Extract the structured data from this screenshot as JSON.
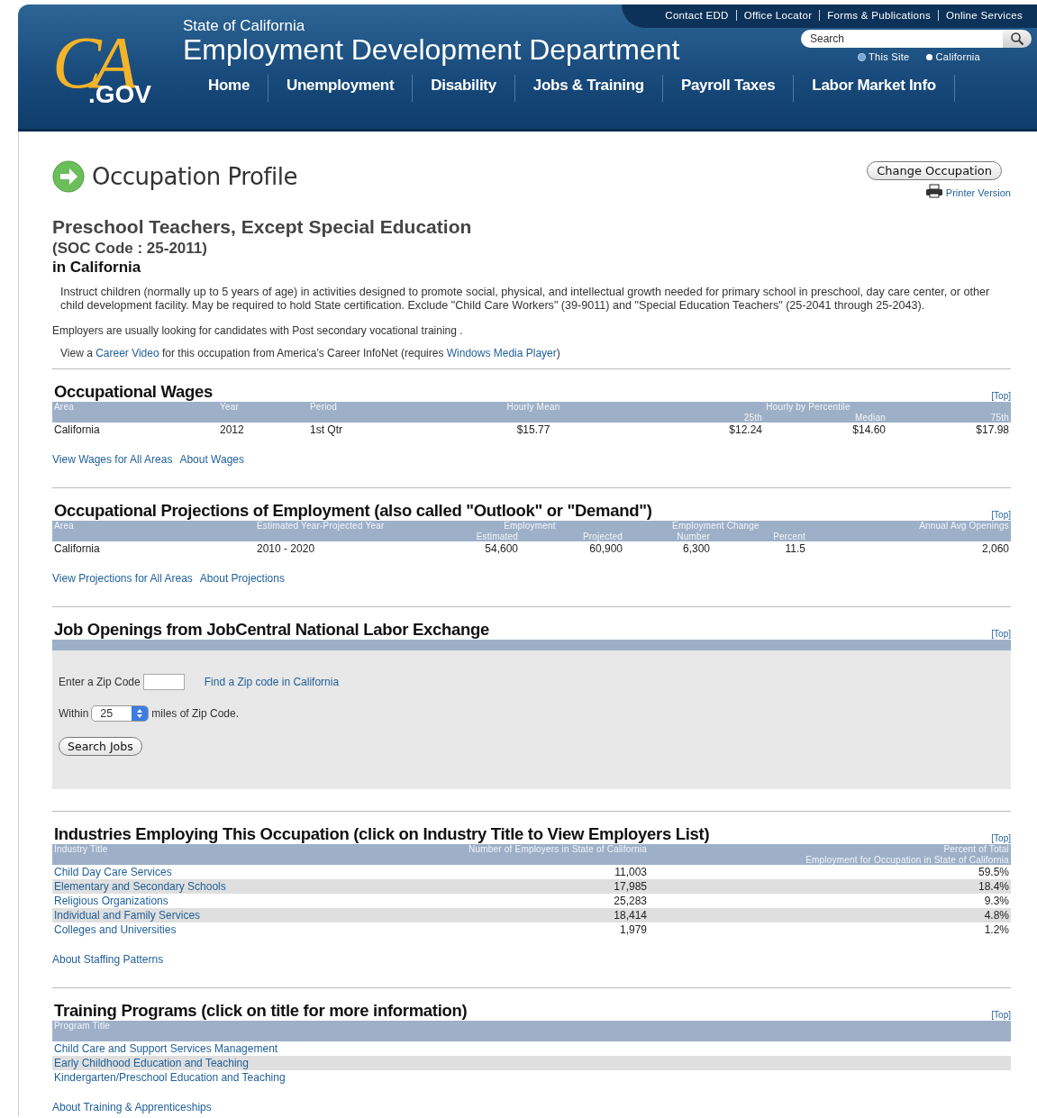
{
  "header": {
    "logo_mark": "CA",
    "logo_suffix": ".GOV",
    "state": "State of California",
    "department": "Employment Development Department",
    "utility_links": [
      "Contact EDD",
      "Office Locator",
      "Forms & Publications",
      "Online Services"
    ],
    "search": {
      "placeholder": "Search"
    },
    "search_scopes": [
      {
        "label": "This Site",
        "selected": true
      },
      {
        "label": "California",
        "selected": false
      }
    ],
    "nav": [
      "Home",
      "Unemployment",
      "Disability",
      "Jobs & Training",
      "Payroll Taxes",
      "Labor Market Info"
    ]
  },
  "profile": {
    "title": "Occupation Profile",
    "change_button": "Change Occupation",
    "printer_link": "Printer Version",
    "occupation": "Preschool Teachers, Except Special Education",
    "soc": "(SOC Code : 25-2011)",
    "location": "in California",
    "description": "Instruct children (normally up to 5 years of age) in activities designed to promote social, physical, and intellectual growth needed for primary school in preschool, day care center, or other child development facility. May be required to hold State certification. Exclude \"Child Care Workers\" (39-9011) and \"Special Education Teachers\" (25-2041 through 25-2043).",
    "education_note": "Employers are usually looking for candidates with Post secondary vocational training .",
    "video_note": [
      {
        "kind": "text",
        "text": "View a "
      },
      {
        "kind": "link",
        "text": "Career Video"
      },
      {
        "kind": "text",
        "text": " for this occupation from America's Career InfoNet (requires "
      },
      {
        "kind": "link",
        "text": "Windows Media Player"
      },
      {
        "kind": "text",
        "text": ")"
      }
    ]
  },
  "sections": [
    {
      "kind": "wages",
      "title": "Occupational Wages",
      "top_link": "[Top]",
      "header_groups": [
        "Hourly by Percentile"
      ],
      "columns": [
        "Area",
        "Year",
        "Period",
        "Hourly Mean",
        "25th",
        "Median",
        "75th"
      ],
      "rows": [
        [
          "California",
          "2012",
          "1st Qtr",
          "$15.77",
          "$12.24",
          "$14.60",
          "$17.98"
        ]
      ],
      "links": [
        "View Wages for All Areas",
        "About Wages"
      ]
    },
    {
      "kind": "projections",
      "title": "Occupational Projections of Employment (also called \"Outlook\" or \"Demand\")",
      "top_link": "[Top]",
      "header_groups": [
        "Employment",
        "Employment Change"
      ],
      "columns": [
        "Area",
        "Estimated Year-Projected Year",
        "Estimated",
        "Projected",
        "Number",
        "Percent",
        "Annual Avg Openings"
      ],
      "rows": [
        [
          "California",
          "2010 - 2020",
          "54,600",
          "60,900",
          "6,300",
          "11.5",
          "2,060"
        ]
      ],
      "links": [
        "View Projections for All Areas",
        "About Projections"
      ]
    },
    {
      "kind": "jobs",
      "title": "Job Openings from JobCentral National Labor Exchange",
      "top_link": "[Top]",
      "zip_label": "Enter a Zip Code",
      "zip_link": "Find a Zip code in California",
      "within_label": "Within",
      "radius": "25",
      "miles_label": "miles of Zip Code.",
      "search_button": "Search Jobs"
    },
    {
      "kind": "industries",
      "title": "Industries Employing This Occupation (click on Industry Title to View Employers List)",
      "top_link": "[Top]",
      "header_groups": [
        "Percent of Total"
      ],
      "columns": [
        "Industry Title",
        "Number of Employers in State of California",
        "Employment for Occupation in State of California"
      ],
      "rows": [
        [
          "Child Day Care Services",
          "11,003",
          "59.5%"
        ],
        [
          "Elementary and Secondary Schools",
          "17,985",
          "18.4%"
        ],
        [
          "Religious Organizations",
          "25,283",
          "9.3%"
        ],
        [
          "Individual and Family Services",
          "18,414",
          "4.8%"
        ],
        [
          "Colleges and Universities",
          "1,979",
          "1.2%"
        ]
      ],
      "links": [
        "About Staffing Patterns"
      ]
    },
    {
      "kind": "training",
      "title": "Training Programs (click on title for more information)",
      "top_link": "[Top]",
      "columns": [
        "Program Title"
      ],
      "rows": [
        [
          "Child Care and Support Services Management"
        ],
        [
          "Early Childhood Education and Teaching"
        ],
        [
          "Kindergarten/Preschool Education and Teaching"
        ]
      ],
      "links": [
        "About Training & Apprenticeships"
      ]
    }
  ]
}
